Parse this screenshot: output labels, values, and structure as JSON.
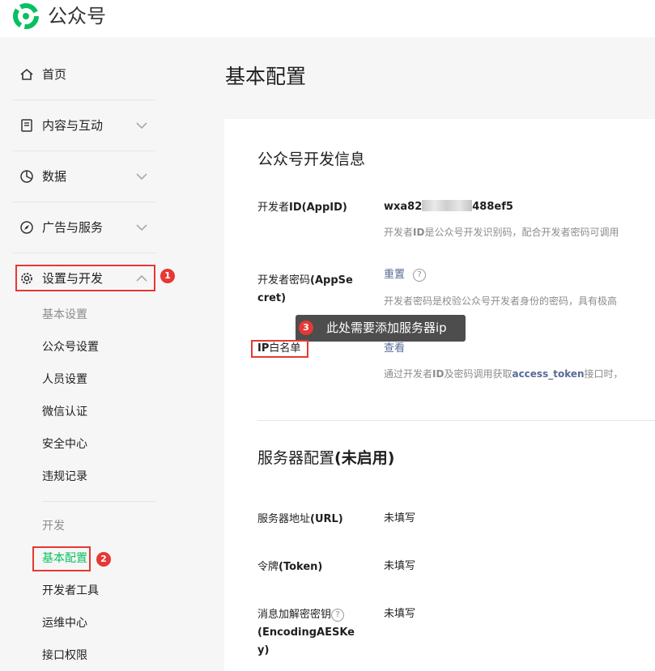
{
  "app": {
    "title": "公众号"
  },
  "sidebar": {
    "items": [
      {
        "label": "首页"
      },
      {
        "label": "内容与互动"
      },
      {
        "label": "数据"
      },
      {
        "label": "广告与服务"
      },
      {
        "label": "设置与开发"
      }
    ],
    "settings_subitems": [
      "基本设置",
      "公众号设置",
      "人员设置",
      "微信认证",
      "安全中心",
      "违规记录"
    ],
    "dev_header": "开发",
    "dev_subitems": [
      "基本配置",
      "开发者工具",
      "运维中心",
      "接口权限"
    ]
  },
  "annotations": {
    "badge1": "1",
    "badge2": "2",
    "badge3": "3",
    "tooltip": "此处需要添加服务器ip"
  },
  "main": {
    "title": "基本配置",
    "dev_info": {
      "title": "公众号开发信息",
      "appid_label": "开发者",
      "appid_label_bold": "ID(AppID)",
      "appid_prefix": "wxa82",
      "appid_suffix": "488ef5",
      "appid_desc_a": "开发者",
      "appid_desc_b": "ID",
      "appid_desc_c": "是公众号开发识别码，配合开发者密码可调用",
      "secret_label": "开发者密码",
      "secret_label_bold1": "(AppSe",
      "secret_label_bold2": "cret)",
      "reset_link": "重置",
      "help_mark": "?",
      "secret_desc": "开发者密码是校验公众号开发者身份的密码，具有极高",
      "ip_label_bold": "IP",
      "ip_label": "白名单",
      "view_link": "查看",
      "ip_desc_a": "通过开发者",
      "ip_desc_b": "ID",
      "ip_desc_c": "及密码调用获取",
      "ip_desc_token": "access_token",
      "ip_desc_d": "接口时，"
    },
    "server": {
      "title": "服务器配置",
      "title_status": "(未启用)",
      "url_label": "服务器地址",
      "url_label_bold": "(URL)",
      "url_value": "未填写",
      "token_label": "令牌",
      "token_label_bold": "(Token)",
      "token_value": "未填写",
      "aes_label": "消息加解密密钥",
      "aes_help": "?",
      "aes_label_bold1": "(EncodingAESKe",
      "aes_label_bold2": "y)",
      "aes_value": "未填写"
    }
  },
  "colors": {
    "brand_green": "#07c160",
    "highlight_red": "#e53935",
    "link": "#576b95"
  }
}
